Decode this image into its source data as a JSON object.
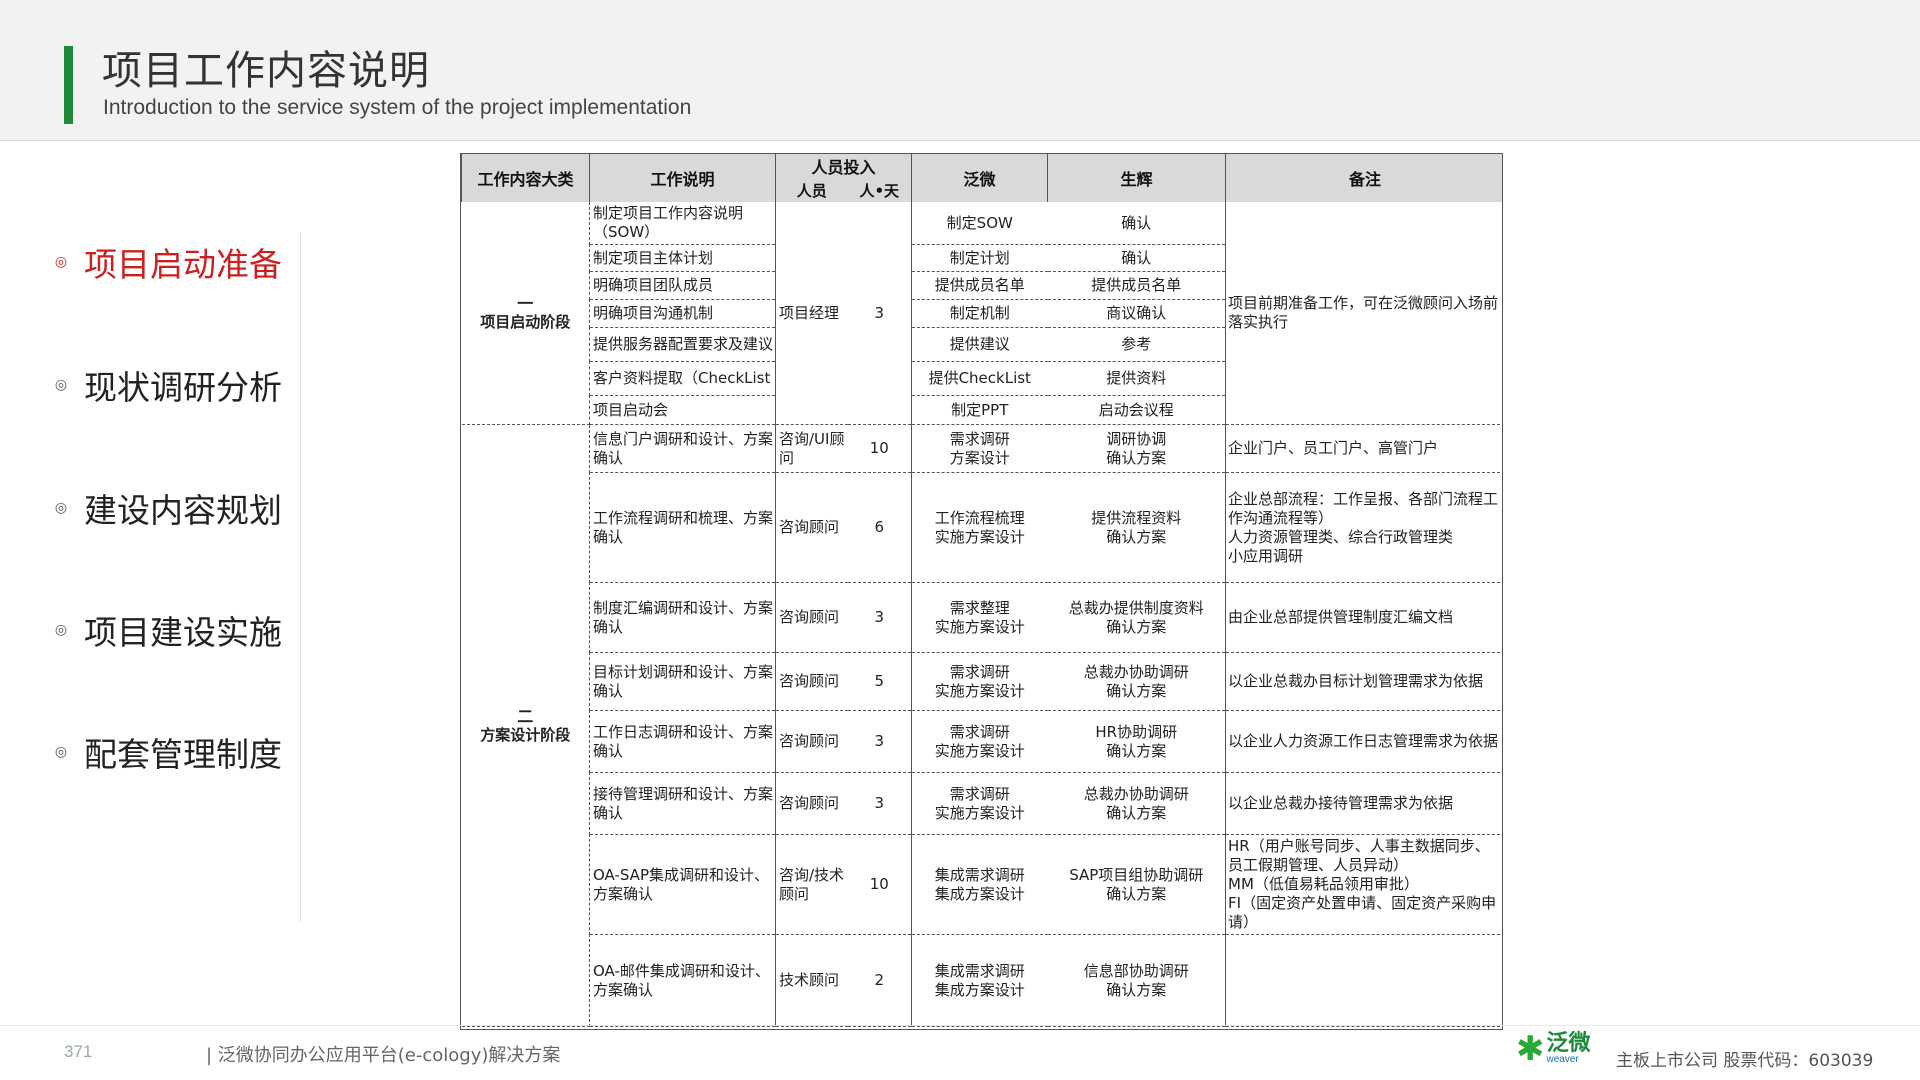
{
  "header": {
    "title": "项目工作内容说明",
    "subtitle": "Introduction to the service system of the project implementation"
  },
  "nav": {
    "items": [
      {
        "label": "项目启动准备",
        "active": true
      },
      {
        "label": "现状调研分析",
        "active": false
      },
      {
        "label": "建设内容规划",
        "active": false
      },
      {
        "label": "项目建设实施",
        "active": false
      },
      {
        "label": "配套管理制度",
        "active": false
      }
    ]
  },
  "table": {
    "headers": {
      "category": "工作内容大类",
      "description": "工作说明",
      "staffing": "人员投入",
      "staff": "人员",
      "days": "人•天",
      "fanwei": "泛微",
      "client": "生辉",
      "remark": "备注"
    },
    "phases": [
      {
        "num": "一",
        "name": "项目启动阶段",
        "staff": "项目经理",
        "days": "3",
        "remark": "项目前期准备工作，可在泛微顾问入场前落实执行",
        "rows": [
          {
            "desc": "制定项目工作内容说明（SOW）",
            "fanwei": "制定SOW",
            "client": "确认"
          },
          {
            "desc": "制定项目主体计划",
            "fanwei": "制定计划",
            "client": "确认"
          },
          {
            "desc": "明确项目团队成员",
            "fanwei": "提供成员名单",
            "client": "提供成员名单"
          },
          {
            "desc": "明确项目沟通机制",
            "fanwei": "制定机制",
            "client": "商议确认"
          },
          {
            "desc": "提供服务器配置要求及建议",
            "fanwei": "提供建议",
            "client": "参考"
          },
          {
            "desc": "客户资料提取（CheckList",
            "fanwei": "提供CheckList",
            "client": "提供资料"
          },
          {
            "desc": "项目启动会",
            "fanwei": "制定PPT",
            "client": "启动会议程"
          }
        ]
      },
      {
        "num": "二",
        "name": "方案设计阶段",
        "rows": [
          {
            "desc": "信息门户调研和设计、方案确认",
            "staff": "咨询/UI顾问",
            "days": "10",
            "fanwei": "需求调研\n方案设计",
            "client": "调研协调\n确认方案",
            "remark": "企业门户、员工门户、高管门户"
          },
          {
            "desc": "工作流程调研和梳理、方案确认",
            "staff": "咨询顾问",
            "days": "6",
            "fanwei": "工作流程梳理\n实施方案设计",
            "client": "提供流程资料\n确认方案",
            "remark": "企业总部流程：工作呈报、各部门流程工作沟通流程等）\n人力资源管理类、综合行政管理类\n小应用调研"
          },
          {
            "desc": "制度汇编调研和设计、方案确认",
            "staff": "咨询顾问",
            "days": "3",
            "fanwei": "需求整理\n实施方案设计",
            "client": "总裁办提供制度资料\n确认方案",
            "remark": "由企业总部提供管理制度汇编文档"
          },
          {
            "desc": "目标计划调研和设计、方案确认",
            "staff": "咨询顾问",
            "days": "5",
            "fanwei": "需求调研\n实施方案设计",
            "client": "总裁办协助调研\n确认方案",
            "remark": "以企业总裁办目标计划管理需求为依据"
          },
          {
            "desc": "工作日志调研和设计、方案确认",
            "staff": "咨询顾问",
            "days": "3",
            "fanwei": "需求调研\n实施方案设计",
            "client": "HR协助调研\n确认方案",
            "remark": "以企业人力资源工作日志管理需求为依据"
          },
          {
            "desc": "接待管理调研和设计、方案确认",
            "staff": "咨询顾问",
            "days": "3",
            "fanwei": "需求调研\n实施方案设计",
            "client": "总裁办协助调研\n确认方案",
            "remark": "以企业总裁办接待管理需求为依据"
          },
          {
            "desc": "OA-SAP集成调研和设计、方案确认",
            "staff": "咨询/技术顾问",
            "days": "10",
            "fanwei": "集成需求调研\n集成方案设计",
            "client": "SAP项目组协助调研\n确认方案",
            "remark": "HR（用户账号同步、人事主数据同步、员工假期管理、人员异动）\nMM（低值易耗品领用审批）\nFI（固定资产处置申请、固定资产采购申请）"
          },
          {
            "desc": "OA-邮件集成调研和设计、方案确认",
            "staff": "技术顾问",
            "days": "2",
            "fanwei": "集成需求调研\n集成方案设计",
            "client": "信息部协助调研\n确认方案",
            "remark": ""
          }
        ]
      }
    ]
  },
  "footer": {
    "page_number": "371",
    "doc_title": "| 泛微协同办公应用平台(e-cology)解决方案",
    "logo_cn": "泛微",
    "logo_en": "weaver",
    "listed_text": "主板上市公司    股票代码：603039"
  }
}
